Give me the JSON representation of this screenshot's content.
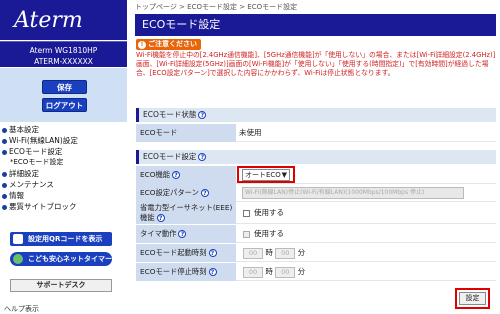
{
  "sidebar": {
    "logo": "Aterm",
    "model_line1": "Aterm WG1810HP",
    "model_line2": "ATERM-XXXXXX",
    "save_label": "保存",
    "logout_label": "ログアウト",
    "menu": [
      {
        "label": "基本設定"
      },
      {
        "label": "Wi-Fi(無線LAN)設定"
      },
      {
        "label": "ECOモード設定"
      },
      {
        "label": "*ECOモード設定",
        "sub": true
      },
      {
        "label": "詳細設定"
      },
      {
        "label": "メンテナンス"
      },
      {
        "label": "情報"
      },
      {
        "label": "悪質サイトブロック"
      }
    ],
    "qr_button": "設定用QRコードを表示",
    "kids_button": "こども安心ネットタイマー",
    "support_label": "サポートデスク",
    "help_label": "ヘルプ表示"
  },
  "breadcrumb": "トップページ > ECOモード設定 > ECOモード設定",
  "page_title": "ECOモード設定",
  "notice": {
    "heading": "ご注意ください",
    "text": "Wi-Fi機能を停止中の[2.4GHz通信機能]、[5GHz通信機能]が「使用しない」の場合、または[Wi-Fi詳細設定(2.4GHz)]画面、[Wi-Fi詳細設定(5GHz)]画面の[Wi-Fi機能]が「使用しない」「使用する(時間指定)」で[有効時間]が経過した場合、[ECO設定パターン]で選択した内容にかかわらず、Wi-Fiは停止状態となります。"
  },
  "status_section": {
    "heading": "ECOモード状態",
    "label": "ECOモード",
    "value": "未使用"
  },
  "settings_section": {
    "heading": "ECOモード設定",
    "rows": {
      "eco_function": {
        "label": "ECO機能",
        "value": "オートECO"
      },
      "eco_pattern": {
        "label": "ECO設定パターン",
        "value": "Wi-Fi(無線LAN)停止(Wi-Fi/有線LAN)(1000Mbps/100Mbps 停止)"
      },
      "ieee": {
        "label": "省電力型イーサネット(EEE)機能",
        "check_label": "使用する"
      },
      "timer": {
        "label": "タイマ動作",
        "check_label": "使用する"
      },
      "start_time": {
        "label": "ECOモード起動時刻",
        "hour": "00",
        "minute": "00",
        "hour_unit": "時",
        "minute_unit": "分"
      },
      "stop_time": {
        "label": "ECOモード停止時刻",
        "hour": "00",
        "minute": "00",
        "hour_unit": "時",
        "minute_unit": "分"
      }
    }
  },
  "set_button": "設定",
  "help_icon": "?",
  "colors": {
    "brand": "#1a1a96",
    "warning": "#e8650a",
    "highlight": "#e00000"
  }
}
